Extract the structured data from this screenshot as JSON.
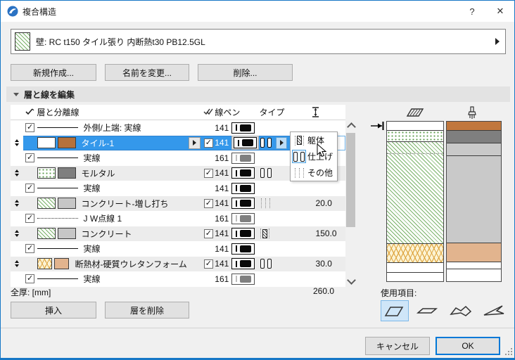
{
  "window": {
    "title": "複合構造",
    "help_label": "?",
    "close_label": "✕"
  },
  "composite_selector": {
    "label": "壁: RC t150 タイル張り 内断熱t30 PB12.5GL"
  },
  "actions": {
    "new": "新規作成...",
    "rename": "名前を変更...",
    "delete": "削除..."
  },
  "section": {
    "title": "層と線を編集"
  },
  "table": {
    "headers": {
      "name": "層と分離線",
      "pen": "線ペン",
      "type": "タイプ"
    },
    "rows": [
      {
        "kind": "sep",
        "checked": true,
        "line": "solid",
        "name": "外側/上端: 実線",
        "pen": "141",
        "shade": "black"
      },
      {
        "kind": "layer",
        "selected": true,
        "fill": "tile",
        "surface": "#b5713b",
        "name": "タイル-1",
        "expander": true,
        "checked": true,
        "pen": "141",
        "shade": "black",
        "type": "finish",
        "dropdown": true,
        "thickness": ""
      },
      {
        "kind": "sep",
        "checked": true,
        "line": "solid",
        "name": "実線",
        "pen": "161",
        "shade": "gray"
      },
      {
        "kind": "layer",
        "fill": "dots",
        "surface": "#7f7f7f",
        "name": "モルタル",
        "checked": true,
        "pen": "141",
        "shade": "black",
        "type": "finish",
        "thickness": ""
      },
      {
        "kind": "sep",
        "checked": true,
        "line": "solid",
        "name": "実線",
        "pen": "141",
        "shade": "black"
      },
      {
        "kind": "layer",
        "fill": "hatch",
        "surface": "#c6c6c6",
        "name": "コンクリート-増し打ち",
        "checked": true,
        "pen": "141",
        "shade": "black",
        "type": "other",
        "thickness": "20.0"
      },
      {
        "kind": "sep",
        "checked": true,
        "line": "dotted",
        "name": "J W点線 1",
        "pen": "161",
        "shade": "gray"
      },
      {
        "kind": "layer",
        "fill": "hatch",
        "surface": "#c6c6c6",
        "name": "コンクリート",
        "checked": true,
        "pen": "141",
        "shade": "black",
        "type": "core",
        "thickness": "150.0"
      },
      {
        "kind": "sep",
        "checked": true,
        "line": "solid",
        "name": "実線",
        "pen": "141",
        "shade": "black"
      },
      {
        "kind": "layer",
        "fill": "zigzag",
        "surface": "#e2b48e",
        "name": "断熱材-硬質ウレタンフォーム",
        "checked": true,
        "pen": "141",
        "shade": "black",
        "type": "finish",
        "thickness": "30.0"
      },
      {
        "kind": "sep",
        "checked": true,
        "line": "solid",
        "name": "実線",
        "pen": "161",
        "shade": "gray"
      }
    ]
  },
  "type_menu": {
    "items": [
      {
        "icon": "core",
        "label": "躯体",
        "selected": false
      },
      {
        "icon": "finish",
        "label": "仕上げ",
        "selected": true
      },
      {
        "icon": "other",
        "label": "その他",
        "selected": false
      }
    ]
  },
  "total": {
    "label": "全厚: [mm]",
    "value": "260.0"
  },
  "bottom_actions": {
    "insert": "挿入",
    "delete_layer": "層を削除"
  },
  "preview": {
    "left_strip": [
      {
        "h": 13,
        "fill": "white",
        "div": "solid"
      },
      {
        "h": 16,
        "fill": "dots",
        "div": "solid"
      },
      {
        "h": 17,
        "fill": "hatch",
        "div": "dotted"
      },
      {
        "h": 128,
        "fill": "hatch",
        "div": "solid"
      },
      {
        "h": 27,
        "fill": "zigzag",
        "div": "solid"
      },
      {
        "h": 14,
        "fill": "white",
        "div": "solid"
      },
      {
        "h": 12,
        "fill": "white",
        "div": ""
      }
    ],
    "right_strip": [
      {
        "h": 13,
        "fill": "#c1773d",
        "div": "solid"
      },
      {
        "h": 18,
        "fill": "#7f7f7f",
        "div": "solid"
      },
      {
        "h": 18,
        "fill": "#c9c9c9",
        "div": "solid"
      },
      {
        "h": 124,
        "fill": "#c9c9c9",
        "div": "solid"
      },
      {
        "h": 27,
        "fill": "#e2b48e",
        "div": "solid"
      },
      {
        "h": 10,
        "fill": "#ffffff",
        "div": "solid"
      },
      {
        "h": 17,
        "fill": "#ffffff",
        "div": ""
      }
    ]
  },
  "usage": {
    "label": "使用項目:",
    "items": [
      {
        "icon": "wall-icon",
        "selected": true
      },
      {
        "icon": "slab-icon",
        "selected": false
      },
      {
        "icon": "roof-icon",
        "selected": false
      },
      {
        "icon": "shell-icon",
        "selected": false
      }
    ]
  },
  "footer": {
    "cancel": "キャンセル",
    "ok": "OK"
  },
  "icons": {
    "app": "archicad-logo-icon",
    "header_visibility": "check-icon",
    "header_pen_visibility": "double-check-icon",
    "header_thickness": "thickness-icon",
    "preview_left": "cut-fill-icon",
    "preview_right": "brush-icon",
    "pointer": "mouse-cursor-icon"
  },
  "colors": {
    "selection": "#3498eb",
    "accent": "#0078d7",
    "row_alt": "#ececec",
    "hatch_green": "#7ab269",
    "zigzag_orange": "#dc9f35"
  }
}
